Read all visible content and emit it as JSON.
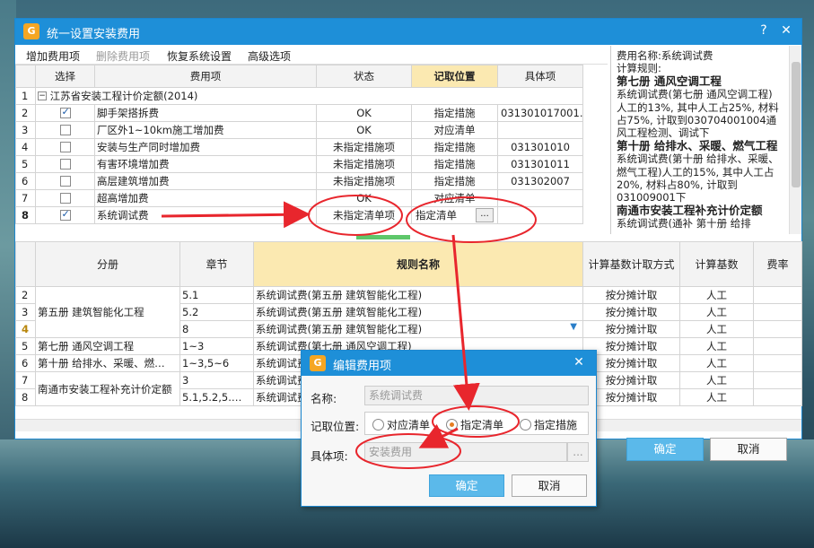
{
  "window": {
    "title": "统一设置安装费用",
    "help": "?",
    "close": "✕"
  },
  "toolbar": {
    "add": "增加费用项",
    "delete": "删除费用项",
    "restore": "恢复系统设置",
    "advanced": "高级选项"
  },
  "fee_table": {
    "headers": [
      "选择",
      "费用项",
      "状态",
      "记取位置",
      "具体项"
    ],
    "group": "江苏省安装工程计价定额(2014)",
    "rows": [
      {
        "no": "2",
        "checked": true,
        "name": "脚手架搭拆费",
        "status": "OK",
        "pos": "指定措施",
        "item": "031301017001…"
      },
      {
        "no": "3",
        "checked": false,
        "name": "厂区外1~10km施工增加费",
        "status": "OK",
        "pos": "对应清单",
        "item": ""
      },
      {
        "no": "4",
        "checked": false,
        "name": "安装与生产同时增加费",
        "status": "未指定措施项",
        "pos": "指定措施",
        "item": "031301010"
      },
      {
        "no": "5",
        "checked": false,
        "name": "有害环境增加费",
        "status": "未指定措施项",
        "pos": "指定措施",
        "item": "031301011"
      },
      {
        "no": "6",
        "checked": false,
        "name": "高层建筑增加费",
        "status": "未指定措施项",
        "pos": "指定措施",
        "item": "031302007"
      },
      {
        "no": "7",
        "checked": false,
        "name": "超高增加费",
        "status": "OK",
        "pos": "对应清单",
        "item": ""
      },
      {
        "no": "8",
        "checked": true,
        "name": "系统调试费",
        "status": "未指定清单项",
        "pos": "指定清单",
        "item": "..."
      }
    ]
  },
  "info": {
    "l1": "费用名称:系统调试费",
    "l2": "计算规则:",
    "h1": "第七册 通风空调工程",
    "p1": "系统调试费(第七册 通风空调工程)人工的13%, 其中人工占25%, 材料占75%, 计取到030704001004通风工程检测、调试下",
    "h2": "第十册 给排水、采暖、燃气工程",
    "p2": "系统调试费(第十册 给排水、采暖、燃气工程)人工的15%, 其中人工占20%, 材料占80%, 计取到031009001下",
    "h3": "南通市安装工程补充计价定额",
    "p3": "系统调试费(通补 第十册 给排"
  },
  "rule_table": {
    "headers": [
      "分册",
      "章节",
      "规则名称",
      "计算基数计取方式",
      "计算基数",
      "费率"
    ],
    "rows": [
      {
        "no": "2",
        "vol": "第五册 建筑智能化工程",
        "ch": "5.1",
        "rule": "系统调试费(第五册 建筑智能化工程)",
        "mode": "按分摊计取",
        "base": "人工"
      },
      {
        "no": "3",
        "vol": "",
        "ch": "5.2",
        "rule": "系统调试费(第五册 建筑智能化工程)",
        "mode": "按分摊计取",
        "base": "人工"
      },
      {
        "no": "4",
        "vol": "",
        "ch": "8",
        "rule": "系统调试费(第五册 建筑智能化工程)",
        "mode": "按分摊计取",
        "base": "人工"
      },
      {
        "no": "5",
        "vol": "第七册 通风空调工程",
        "ch": "1~3",
        "rule": "系统调试费(第七册 通风空调工程)",
        "mode": "按分摊计取",
        "base": "人工"
      },
      {
        "no": "6",
        "vol": "第十册 给排水、采暖、燃…",
        "ch": "1~3,5~6",
        "rule": "系统调试费",
        "mode": "按分摊计取",
        "base": "人工"
      },
      {
        "no": "7",
        "vol": "南通市安装工程补充计价定额",
        "ch": "3",
        "rule": "系统调试费",
        "mode": "按分摊计取",
        "base": "人工"
      },
      {
        "no": "8",
        "vol": "",
        "ch": "5.1,5.2,5.…",
        "rule": "系统调试费",
        "mode": "按分摊计取",
        "base": "人工"
      }
    ]
  },
  "footer": {
    "ok": "确定",
    "cancel": "取消"
  },
  "dialog": {
    "title": "编辑费用项",
    "close": "✕",
    "name_label": "名称:",
    "name_value": "系统调试费",
    "pos_label": "记取位置:",
    "opt1": "对应清单",
    "opt2": "指定清单",
    "opt3": "指定措施",
    "item_label": "具体项:",
    "item_value": "安装费用",
    "dots": "...",
    "ok": "确定",
    "cancel": "取消"
  },
  "colors": {
    "titlebar": "#1e8fd8",
    "highlight": "#fbe9b1",
    "annotation": "#e8262d",
    "primary_button": "#5bb9ea"
  }
}
